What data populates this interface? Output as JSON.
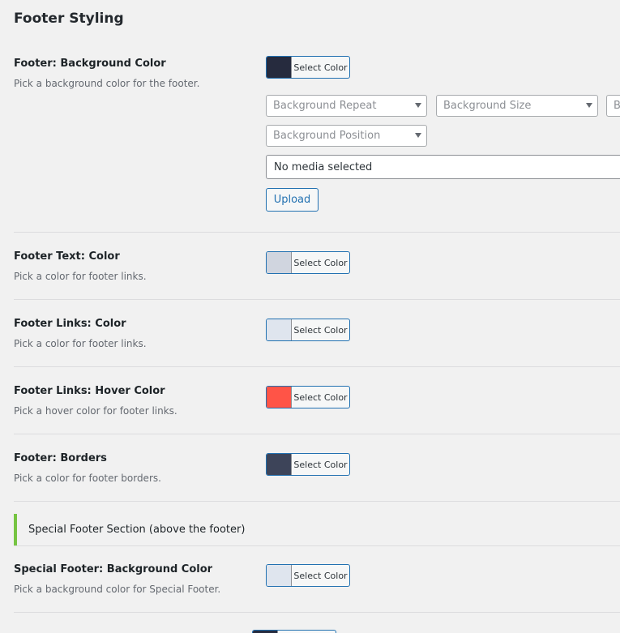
{
  "section": {
    "title": "Footer Styling"
  },
  "button_label": "Select Color",
  "bg_options": {
    "repeat": "Background Repeat",
    "size": "Background Size",
    "attachment_partial": "B",
    "position": "Background Position",
    "media": "No media selected",
    "upload": "Upload"
  },
  "fields": [
    {
      "label": "Footer: Background Color",
      "desc": "Pick a background color for the footer.",
      "swatch": "#262b3e"
    },
    {
      "label": "Footer Text: Color",
      "desc": "Pick a color for footer links.",
      "swatch": "#d0d5df"
    },
    {
      "label": "Footer Links: Color",
      "desc": "Pick a color for footer links.",
      "swatch": "#dfe5ee"
    },
    {
      "label": "Footer Links: Hover Color",
      "desc": "Pick a hover color for footer links.",
      "swatch": "#ff5447"
    },
    {
      "label": "Footer: Borders",
      "desc": "Pick a color for footer borders.",
      "swatch": "#3d4459"
    },
    {
      "label": "Special Footer: Background Color",
      "desc": "Pick a background color for Special Footer.",
      "swatch": "#dfe5ee"
    }
  ],
  "special_section": {
    "title": "Special Footer Section (above the footer)"
  },
  "partial_next_swatch": "#262b3e",
  "accent_color": "#2271b1",
  "section_marker_color": "#76c442"
}
